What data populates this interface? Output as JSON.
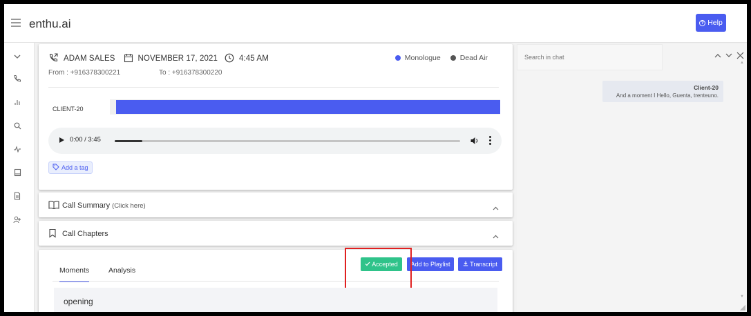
{
  "app": {
    "brand": "enthu.ai",
    "help_label": "Help"
  },
  "sidebar": {
    "icons": [
      "chevron-down-icon",
      "calls-icon",
      "analytics-icon",
      "search-icon",
      "activity-icon",
      "book-icon",
      "document-icon",
      "add-user-icon"
    ]
  },
  "call": {
    "agent": "ADAM SALES",
    "date": "NOVEMBER 17, 2021",
    "time": "4:45 AM",
    "from": "From : +916378300221",
    "to": "To : +916378300220",
    "legend": [
      {
        "label": "Monologue",
        "color": "#4a5cf0"
      },
      {
        "label": "Dead Air",
        "color": "#555555"
      }
    ],
    "speaker_label": "CLIENT-20",
    "audio": {
      "time": "0:00 / 3:45",
      "progress": 0.08
    },
    "add_tag_label": "Add a tag"
  },
  "accordions": {
    "summary_title": "Call Summary",
    "summary_hint": "(Click here)",
    "chapters_title": "Call Chapters"
  },
  "moments": {
    "tabs": {
      "moments": "Moments",
      "analysis": "Analysis"
    },
    "buttons": {
      "accepted": "Accepted",
      "playlist": "Add to Playlist",
      "transcript": "Transcript"
    },
    "section_title": "opening"
  },
  "chat": {
    "search_placeholder": "Search in chat",
    "messages": [
      {
        "speaker": "Client-20",
        "text": "And a moment I Hello, Guenta, trenteuno."
      }
    ]
  },
  "colors": {
    "accent": "#4a5cf0",
    "accepted": "#2fc38a",
    "highlight": "#e02020"
  }
}
